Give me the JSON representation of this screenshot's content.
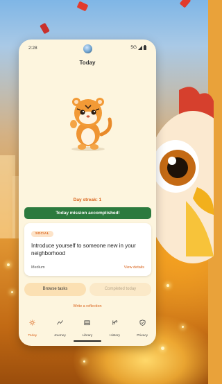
{
  "status_bar": {
    "time": "2:28",
    "network": "5G"
  },
  "screen_title": "Today",
  "streak_text": "Day streak: 1",
  "mission_banner": "Today mission accomplished!",
  "task_card": {
    "tag": "SOCIAL",
    "text": "Introduce yourself to someone new in your neighborhood",
    "difficulty": "Medium",
    "details_link": "View details"
  },
  "buttons": {
    "browse": "Browse tasks",
    "completed": "Completed today"
  },
  "reflection_link": "Write a reflection",
  "nav": [
    {
      "label": "Today",
      "icon": "sun-icon",
      "active": true
    },
    {
      "label": "Journey",
      "icon": "trend-icon",
      "active": false
    },
    {
      "label": "Library",
      "icon": "library-icon",
      "active": false
    },
    {
      "label": "History",
      "icon": "history-icon",
      "active": false
    },
    {
      "label": "Privacy",
      "icon": "shield-icon",
      "active": false
    }
  ],
  "colors": {
    "accent": "#d9621a",
    "success": "#2c7a3e",
    "background": "#fdf5de"
  }
}
